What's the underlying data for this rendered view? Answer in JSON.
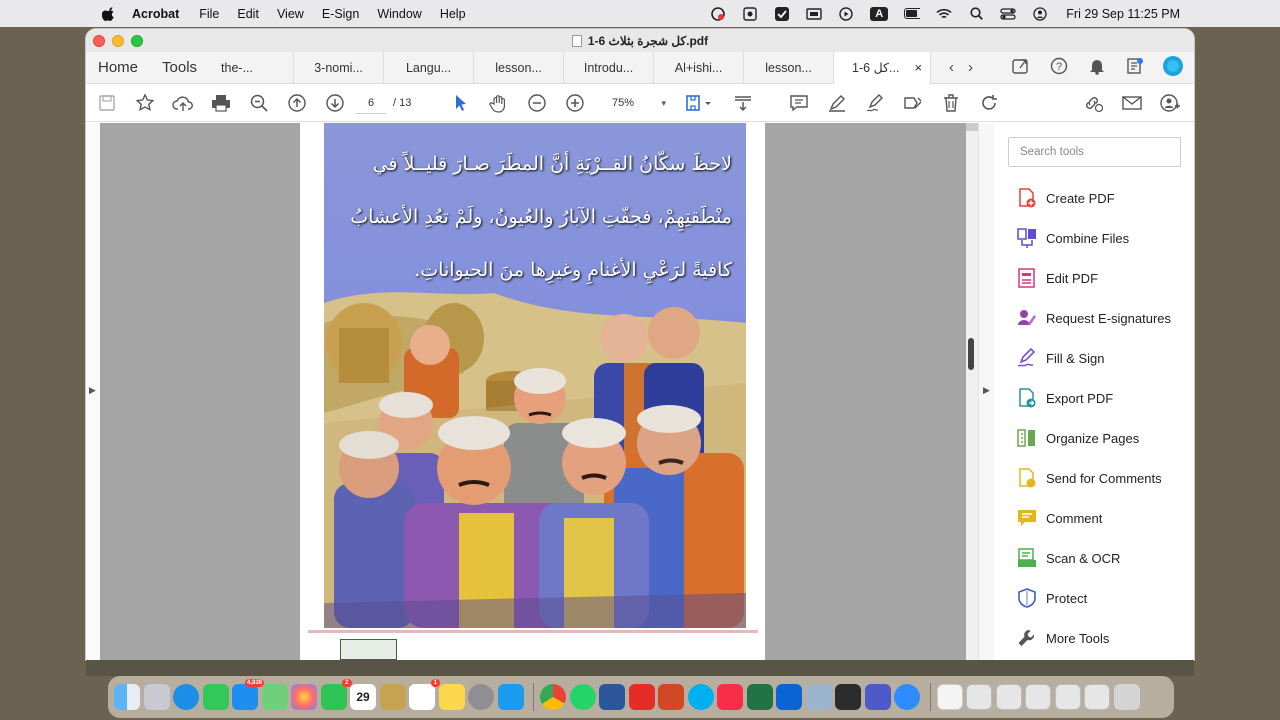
{
  "menubar": {
    "app_name": "Acrobat",
    "items": [
      "File",
      "Edit",
      "View",
      "E-Sign",
      "Window",
      "Help"
    ],
    "input_source": "A",
    "clock": "Fri 29 Sep  11:25 PM"
  },
  "window": {
    "title": "1-6 كل شجرة بثلاث.pdf"
  },
  "tabbar": {
    "home": "Home",
    "tools": "Tools",
    "tabs": [
      "the-...",
      "3-nomi...",
      "Langu...",
      "lesson...",
      "Introdu...",
      "Al+ishi...",
      "lesson..."
    ],
    "active_tab": "1-6 كل...",
    "close": "×",
    "prev": "‹",
    "next": "›"
  },
  "toolbar": {
    "page_current": "6",
    "page_total": "/ 13",
    "zoom": "75%",
    "zoom_caret": "▾"
  },
  "document": {
    "line1": "لاحظَ سكّانُ القــرْيَةِ أنَّ المطَرَ صـارَ قليــلاً في",
    "line2": "منْطَقتِهِمْ، فجفّتِ الآبارُ والعُيونُ، ولَمْ تعُدِ الأعشابُ",
    "line3": "كافيةً لرَعْيِ الأغنامِ وغيرِها منَ الحيواناتِ."
  },
  "panel": {
    "search_placeholder": "Search tools",
    "tools": [
      {
        "label": "Create PDF",
        "color": "#e0443f"
      },
      {
        "label": "Combine Files",
        "color": "#5a4fcf"
      },
      {
        "label": "Edit PDF",
        "color": "#d6367a"
      },
      {
        "label": "Request E-signatures",
        "color": "#8e44ad"
      },
      {
        "label": "Fill & Sign",
        "color": "#7b4fcf"
      },
      {
        "label": "Export PDF",
        "color": "#2a8fa0"
      },
      {
        "label": "Organize Pages",
        "color": "#6aa84f"
      },
      {
        "label": "Send for Comments",
        "color": "#e0b820"
      },
      {
        "label": "Comment",
        "color": "#e0b820"
      },
      {
        "label": "Scan & OCR",
        "color": "#4caf50"
      },
      {
        "label": "Protect",
        "color": "#3f5fbf"
      },
      {
        "label": "More Tools",
        "color": "#555555"
      }
    ]
  },
  "dock": {
    "calendar_day": "29",
    "badges": [
      "4,838",
      "2",
      "1"
    ]
  }
}
